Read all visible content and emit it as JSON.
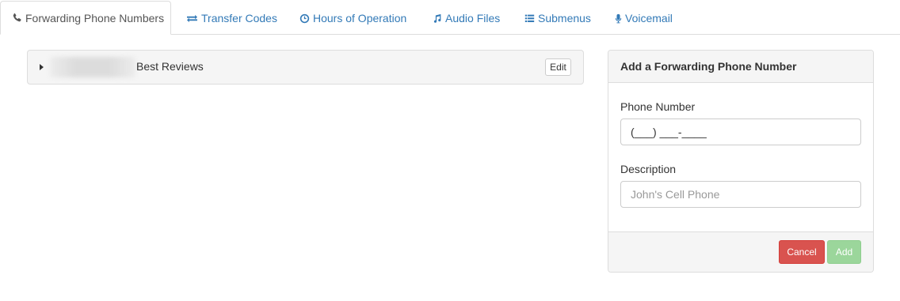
{
  "tabs": [
    {
      "label": "Forwarding Phone Numbers",
      "icon": "phone-icon",
      "active": true
    },
    {
      "label": "Transfer Codes",
      "icon": "exchange-icon",
      "active": false
    },
    {
      "label": "Hours of Operation",
      "icon": "clock-icon",
      "active": false
    },
    {
      "label": "Audio Files",
      "icon": "music-icon",
      "active": false
    },
    {
      "label": "Submenus",
      "icon": "list-icon",
      "active": false
    },
    {
      "label": "Voicemail",
      "icon": "microphone-icon",
      "active": false
    }
  ],
  "group": {
    "title": "Best Reviews",
    "edit_label": "Edit"
  },
  "form": {
    "heading": "Add a Forwarding Phone Number",
    "phone_label": "Phone Number",
    "phone_value": "(___) ___-____",
    "description_label": "Description",
    "description_placeholder": "John's Cell Phone",
    "cancel_label": "Cancel",
    "add_label": "Add"
  },
  "colors": {
    "link": "#337ab7",
    "danger": "#d9534f",
    "success_disabled": "#9bd69b",
    "panel_bg": "#f5f5f5",
    "border": "#dddddd"
  }
}
